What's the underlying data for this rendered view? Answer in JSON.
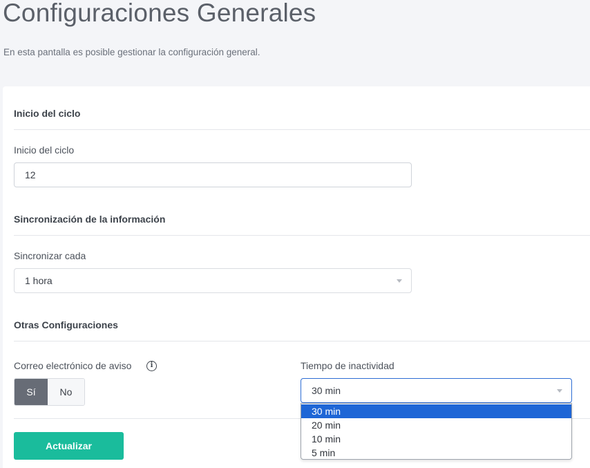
{
  "header": {
    "title": "Configuraciones Generales",
    "subtitle": "En esta pantalla es posible gestionar la configuración general."
  },
  "cycle": {
    "section_title": "Inicio del ciclo",
    "field_label": "Inicio del ciclo",
    "value": "12"
  },
  "sync": {
    "section_title": "Sincronización de la información",
    "field_label": "Sincronizar cada",
    "selected": "1 hora"
  },
  "other": {
    "section_title": "Otras Configuraciones",
    "email_label": "Correo electrónico de aviso",
    "info_icon": "i",
    "toggle": {
      "yes": "Sí",
      "no": "No",
      "active": "yes"
    },
    "inactivity_label": "Tiempo de inactividad",
    "inactivity_selected": "30 min",
    "inactivity_options": [
      "30 min",
      "20 min",
      "10 min",
      "5 min"
    ]
  },
  "actions": {
    "update_label": "Actualizar"
  },
  "colors": {
    "accent": "#1abc9c",
    "toggle_active": "#676c76",
    "option_highlight": "#1e66d6",
    "focus_border": "#2c6cd4"
  },
  "icons": [
    "info-icon",
    "caret-down-icon"
  ]
}
